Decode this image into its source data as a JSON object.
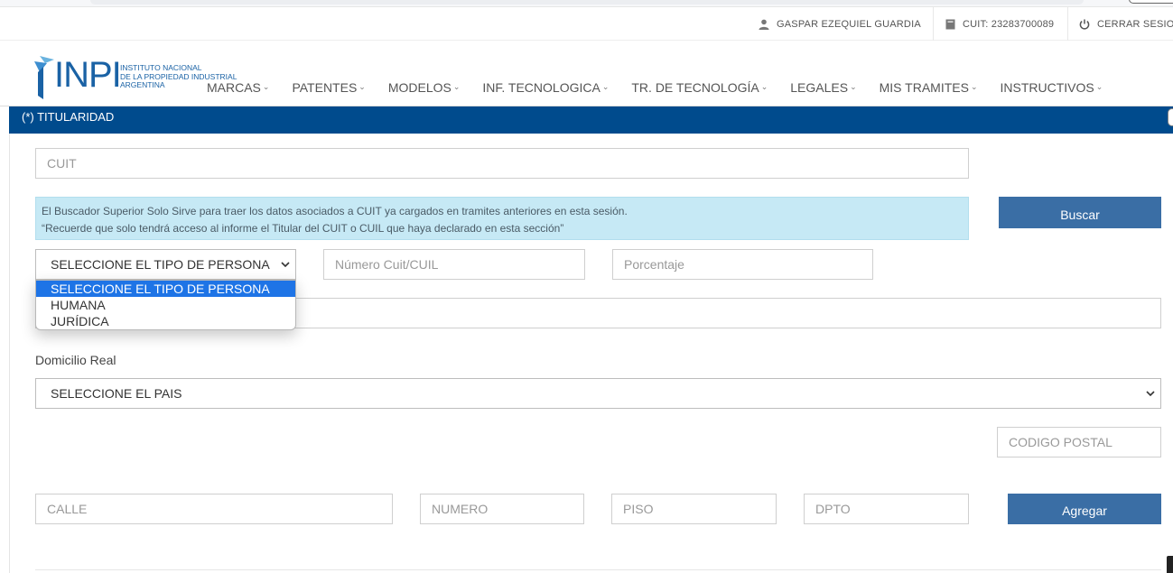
{
  "user_bar": {
    "user_name": "GASPAR EZEQUIEL GUARDIA",
    "cuit": "CUIT: 23283700089",
    "logout": "CERRAR SESION"
  },
  "logo": {
    "mark": "INPI",
    "line1": "INSTITUTO NACIONAL",
    "line2": "DE LA PROPIEDAD INDUSTRIAL",
    "line3": "ARGENTINA"
  },
  "nav": {
    "items": [
      {
        "label": "MARCAS"
      },
      {
        "label": "PATENTES"
      },
      {
        "label": "MODELOS"
      },
      {
        "label": "INF. TECNOLOGICA"
      },
      {
        "label": "TR. DE TECNOLOGÍA"
      },
      {
        "label": "LEGALES"
      },
      {
        "label": "MIS TRAMITES"
      },
      {
        "label": "INSTRUCTIVOS"
      }
    ]
  },
  "section": {
    "title": "(*) TITULARIDAD"
  },
  "form": {
    "cuit_placeholder": "CUIT",
    "info_line1": "El Buscador Superior Solo Sirve para traer los datos asociados a CUIT ya cargados en tramites anteriores en esta sesión.",
    "info_line2": "“Recuerde que solo tendrá acceso al informe el Titular del CUIT o CUIL que haya declarado en esta sección”",
    "search_button": "Buscar",
    "person_type_selected": "SELECCIONE EL TIPO DE PERSONA",
    "person_type_options": [
      "SELECCIONE EL TIPO DE PERSONA",
      "HUMANA",
      "JURÍDICA"
    ],
    "cuit_cuil_placeholder": "Número Cuit/CUIL",
    "percentage_placeholder": "Porcentaje",
    "domicile_label": "Domicilio Real",
    "country_selected": "SELECCIONE EL PAIS",
    "postal_code_placeholder": "CODIGO POSTAL",
    "street_placeholder": "CALLE",
    "number_placeholder": "NUMERO",
    "floor_placeholder": "PISO",
    "apartment_placeholder": "DPTO",
    "add_button": "Agregar"
  },
  "colors": {
    "section_bar": "#004b8d",
    "button": "#3a6ea5",
    "info_bg": "#c6e9f5",
    "brand": "#1a62a5",
    "dropdown_highlight": "#1e74e6"
  }
}
